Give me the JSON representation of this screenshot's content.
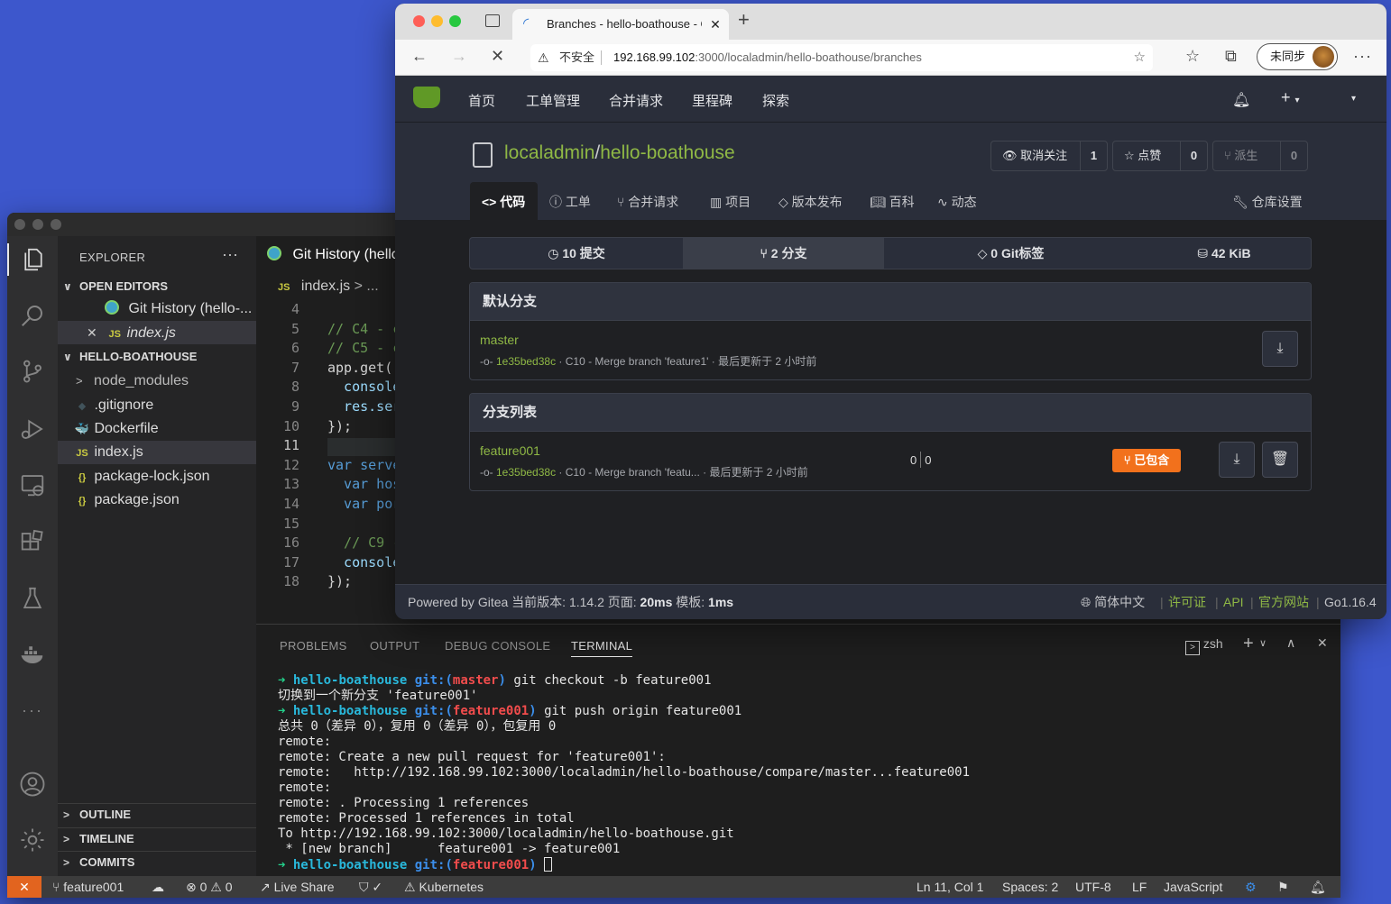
{
  "vscode": {
    "activity_icons": [
      "files-icon",
      "search-icon",
      "source-control-icon",
      "run-debug-icon",
      "remote-explorer-icon",
      "extensions-icon",
      "testing-icon",
      "docker-icon",
      "more-icon",
      "account-icon",
      "settings-gear-icon"
    ],
    "more_glyph": "···",
    "explorer": {
      "title": "EXPLORER",
      "more": "···",
      "open_editors_label": "OPEN EDITORS",
      "open_editors": [
        {
          "label": "Git History (hello-...",
          "icon": "git-history-icon"
        },
        {
          "label": "index.js",
          "icon_text": "JS",
          "close": "✕"
        }
      ],
      "project_label": "HELLO-BOATHOUSE",
      "files": [
        {
          "label": "node_modules",
          "icon": "folder-chevron-icon"
        },
        {
          "label": ".gitignore",
          "icon": "gitignore-icon"
        },
        {
          "label": "Dockerfile",
          "icon": "docker-file-icon"
        },
        {
          "label": "index.js",
          "icon_text": "JS"
        },
        {
          "label": "package-lock.json",
          "icon_text": "{}"
        },
        {
          "label": "package.json",
          "icon_text": "{}"
        }
      ],
      "outline_label": "OUTLINE",
      "timeline_label": "TIMELINE",
      "commits_label": "COMMITS"
    },
    "editor": {
      "tab_label": "Git History (hello",
      "breadcrumb_file": "index.js",
      "breadcrumb_rest": "> ...",
      "lines": [
        {
          "n": "4",
          "code": ""
        },
        {
          "n": "5",
          "code": "// C4 - c"
        },
        {
          "n": "6",
          "code": "// C5 - c"
        },
        {
          "n": "7",
          "code": "app.get('"
        },
        {
          "n": "8",
          "code": "  console"
        },
        {
          "n": "9",
          "code": "  res.ser"
        },
        {
          "n": "10",
          "code": "});"
        },
        {
          "n": "11",
          "code": ""
        },
        {
          "n": "12",
          "code": "var serve"
        },
        {
          "n": "13",
          "code": "  var hos"
        },
        {
          "n": "14",
          "code": "  var por"
        },
        {
          "n": "15",
          "code": ""
        },
        {
          "n": "16",
          "code": "  // C9 -"
        },
        {
          "n": "17",
          "code": "  console"
        },
        {
          "n": "18",
          "code": "});"
        }
      ]
    },
    "panel": {
      "tabs": [
        "PROBLEMS",
        "OUTPUT",
        "DEBUG CONSOLE",
        "TERMINAL"
      ],
      "active_tab": "TERMINAL",
      "shell": "zsh",
      "terminal": [
        {
          "arrow": "➜",
          "dir": "hello-boathouse",
          "git": "git:(",
          "branch": "master",
          "close": ")",
          "cmd": " git checkout -b feature001"
        },
        {
          "text": "切换到一个新分支 'feature001'"
        },
        {
          "arrow": "➜",
          "dir": "hello-boathouse",
          "git": "git:(",
          "branch": "feature001",
          "close": ")",
          "cmd": " git push origin feature001"
        },
        {
          "text": "总共 0（差异 0），复用 0（差异 0），包复用 0"
        },
        {
          "text": "remote:"
        },
        {
          "text": "remote: Create a new pull request for 'feature001':"
        },
        {
          "text": "remote:   http://192.168.99.102:3000/localadmin/hello-boathouse/compare/master...feature001"
        },
        {
          "text": "remote:"
        },
        {
          "text": "remote: . Processing 1 references"
        },
        {
          "text": "remote: Processed 1 references in total"
        },
        {
          "text": "To http://192.168.99.102:3000/localadmin/hello-boathouse.git"
        },
        {
          "text": " * [new branch]      feature001 -> feature001"
        },
        {
          "arrow": "➜",
          "dir": "hello-boathouse",
          "git": "git:(",
          "branch": "feature001",
          "close": ")",
          "cmd": " "
        }
      ]
    },
    "status": {
      "remote_glyph": "✕",
      "branch": "feature001",
      "errors": "0",
      "warnings": "0",
      "live_share": "Live Share",
      "kubernetes": "Kubernetes",
      "position": "Ln 11, Col 1",
      "spaces": "Spaces: 2",
      "encoding": "UTF-8",
      "eol": "LF",
      "language": "JavaScript"
    }
  },
  "browser": {
    "tab_title": "Branches - hello-boathouse - Gitea",
    "new_tab": "+",
    "security": "不安全",
    "url_host": "192.168.99.102",
    "url_path": ":3000/localadmin/hello-boathouse/branches",
    "sync_label": "未同步",
    "more": "···"
  },
  "gitea": {
    "nav": [
      "首页",
      "工单管理",
      "合并请求",
      "里程碑",
      "探索"
    ],
    "owner": "localadmin",
    "sep": "/",
    "repo": "hello-boathouse",
    "unwatch": {
      "label": "取消关注",
      "count": "1"
    },
    "star": {
      "label": "点赞",
      "count": "0"
    },
    "fork": {
      "label": "派生",
      "count": "0"
    },
    "repo_tabs": [
      "代码",
      "工单",
      "合并请求",
      "项目",
      "版本发布",
      "百科",
      "动态"
    ],
    "settings_tab": "仓库设置",
    "stats": {
      "commits": "10 提交",
      "branches": "2 分支",
      "tags": "0 Git标签",
      "size": "42 KiB"
    },
    "default_branch": {
      "header": "默认分支",
      "name": "master",
      "sha": "1e35bed38c",
      "message": "· C10 - Merge branch 'feature1' · 最后更新于 2 小时前"
    },
    "branch_list": {
      "header": "分支列表",
      "items": [
        {
          "name": "feature001",
          "sha": "1e35bed38c",
          "message": "· C10 - Merge branch 'featu... · 最后更新于 2 小时前",
          "ahead": "0",
          "behind": "0",
          "badge": "已包含"
        }
      ]
    },
    "footer": {
      "powered": "Powered by Gitea 当前版本: 1.14.2 页面: ",
      "page_time": "20ms",
      "tmpl_label": " 模板: ",
      "tmpl_time": "1ms",
      "language": "简体中文",
      "license": "许可证",
      "api": "API",
      "website": "官方网站",
      "go": "Go1.16.4"
    }
  },
  "colors": {
    "gitea_green": "#8fb845",
    "badge_orange": "#f2711c",
    "vscode_remote": "#e2641f"
  }
}
